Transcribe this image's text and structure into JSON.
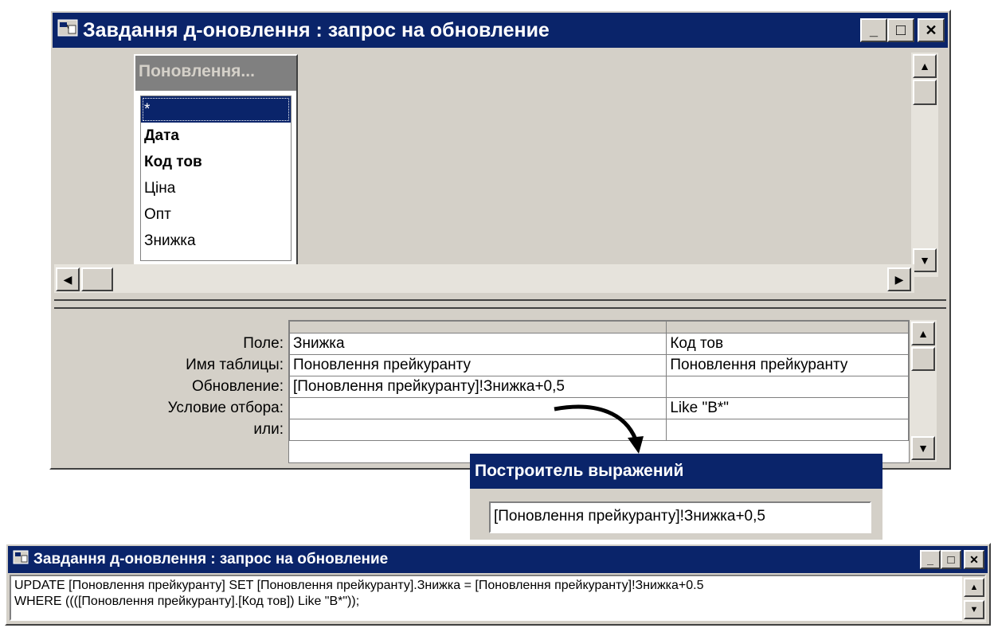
{
  "query_window": {
    "title": "Завдання д-оновлення : запрос на обновление",
    "controls": {
      "minimize": "_",
      "maximize": "□",
      "close": "✕"
    },
    "table": {
      "name": "Поновлення...",
      "fields": [
        "*",
        "Дата",
        "Код тов",
        "Ціна",
        "Опт",
        "Знижка"
      ]
    },
    "grid_labels": {
      "field": "Поле:",
      "table": "Имя таблицы:",
      "update": "Обновление:",
      "criteria": "Условие отбора:",
      "or": "или:"
    },
    "columns": [
      {
        "field": "Знижка",
        "table": "Поновлення прейкуранту",
        "update": "[Поновлення прейкуранту]!Знижка+0,5",
        "criteria": ""
      },
      {
        "field": "Код тов",
        "table": "Поновлення прейкуранту",
        "update": "",
        "criteria": "Like \"В*\""
      }
    ]
  },
  "expression_builder": {
    "title": "Построитель выражений",
    "expression": "[Поновлення прейкуранту]!Знижка+0,5"
  },
  "sql_window": {
    "title": "Завдання д-оновлення : запрос на обновление",
    "line1": "UPDATE [Поновлення прейкуранту] SET [Поновлення прейкуранту].Знижка = [Поновлення прейкуранту]!Знижка+0.5",
    "line2": "WHERE ((([Поновлення прейкуранту].[Код тов]) Like \"В*\"));"
  }
}
